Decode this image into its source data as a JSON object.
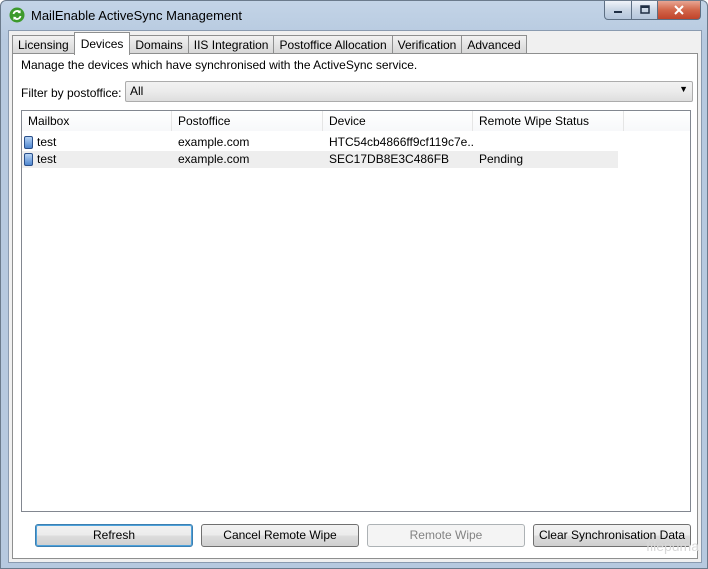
{
  "window": {
    "title": "MailEnable ActiveSync Management",
    "icon": "refresh-sync-icon"
  },
  "tabs": [
    {
      "label": "Licensing",
      "active": false
    },
    {
      "label": "Devices",
      "active": true
    },
    {
      "label": "Domains",
      "active": false
    },
    {
      "label": "IIS Integration",
      "active": false
    },
    {
      "label": "Postoffice Allocation",
      "active": false
    },
    {
      "label": "Verification",
      "active": false
    },
    {
      "label": "Advanced",
      "active": false
    }
  ],
  "devices_page": {
    "description": "Manage the devices which have synchronised with the ActiveSync service.",
    "filter": {
      "label": "Filter by postoffice:",
      "selected": "All"
    },
    "columns": [
      "Mailbox",
      "Postoffice",
      "Device",
      "Remote Wipe Status"
    ],
    "rows": [
      {
        "mailbox": "test",
        "postoffice": "example.com",
        "device": "HTC54cb4866ff9cf119c7e...",
        "status": ""
      },
      {
        "mailbox": "test",
        "postoffice": "example.com",
        "device": "SEC17DB8E3C486FB",
        "status": "Pending"
      }
    ]
  },
  "buttons": {
    "refresh": "Refresh",
    "cancel_remote_wipe": "Cancel Remote Wipe",
    "remote_wipe": "Remote Wipe",
    "clear_sync": "Clear Synchronisation Data"
  },
  "watermark": "filepuma"
}
